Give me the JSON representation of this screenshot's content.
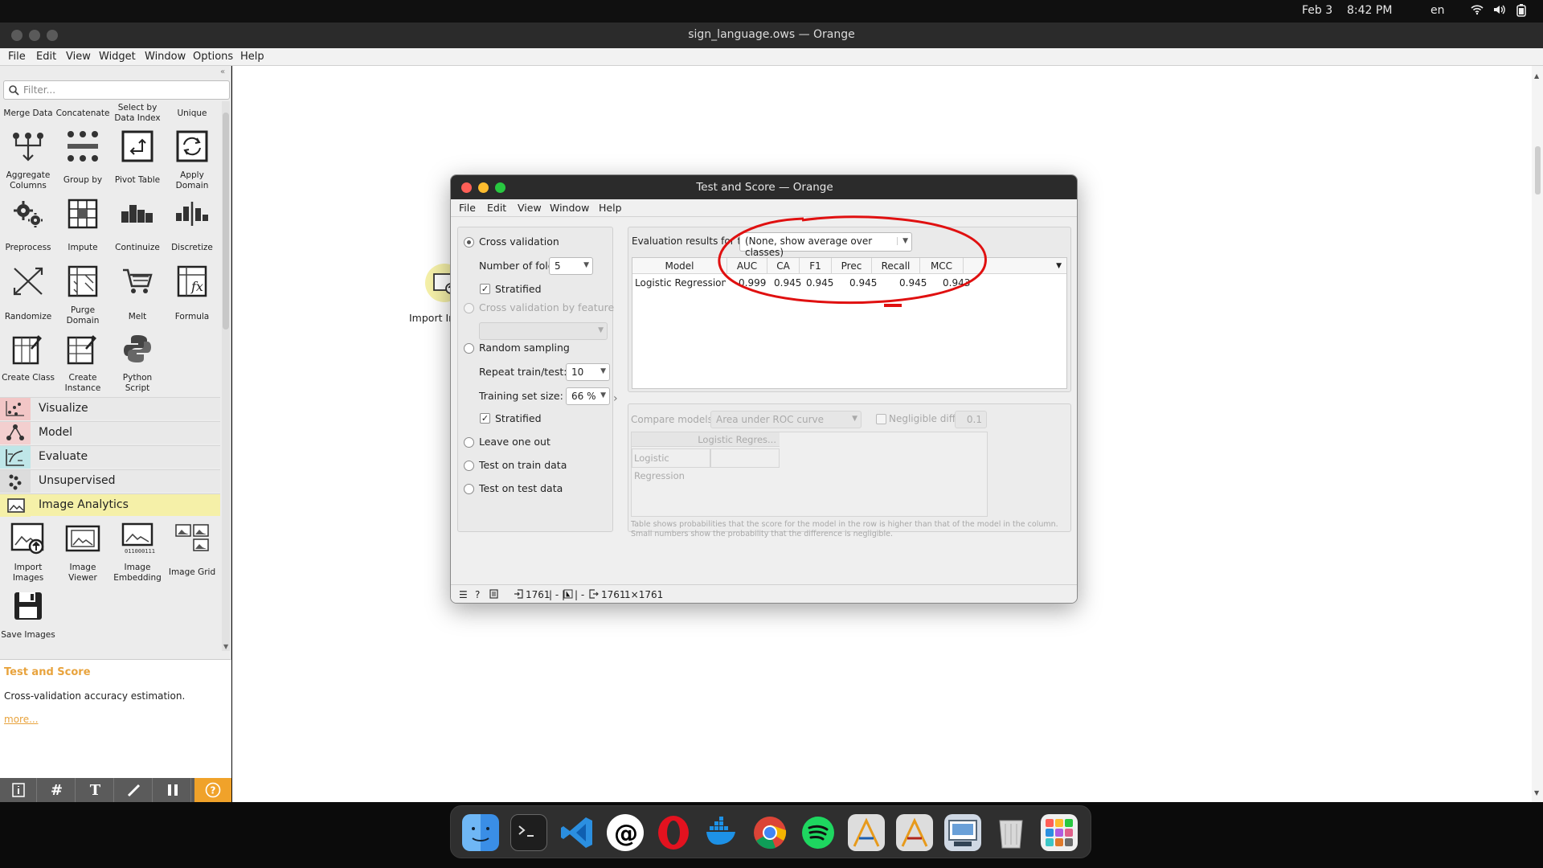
{
  "system_bar": {
    "date": "Feb 3",
    "time": "8:42 PM",
    "lang": "en"
  },
  "window": {
    "title": "sign_language.ows — Orange"
  },
  "app_menu": [
    "File",
    "Edit",
    "View",
    "Widget",
    "Window",
    "Options",
    "Help"
  ],
  "sidebar": {
    "filter_placeholder": "Filter...",
    "widgets_row1": [
      "Merge Data",
      "Concatenate",
      "Select by Data Index",
      "Unique"
    ],
    "widgets_row2": [
      "Aggregate Columns",
      "Group by",
      "Pivot Table",
      "Apply Domain"
    ],
    "widgets_row3": [
      "Preprocess",
      "Impute",
      "Continuize",
      "Discretize"
    ],
    "widgets_row4": [
      "Randomize",
      "Purge Domain",
      "Melt",
      "Formula"
    ],
    "widgets_row5": [
      "Create Class",
      "Create Instance",
      "Python Script"
    ],
    "categories": [
      "Visualize",
      "Model",
      "Evaluate",
      "Unsupervised",
      "Image Analytics"
    ],
    "image_widgets": [
      "Import Images",
      "Image Viewer",
      "Image Embedding",
      "Image Grid",
      "Save Images"
    ],
    "info": {
      "title": "Test and Score",
      "description": "Cross-validation accuracy estimation.",
      "more": "more..."
    }
  },
  "canvas": {
    "node_label": "Import Im"
  },
  "test_score": {
    "title": "Test and Score — Orange",
    "menu": [
      "File",
      "Edit",
      "View",
      "Window",
      "Help"
    ],
    "sampling": {
      "cross_validation": "Cross validation",
      "folds_label": "Number of folds:",
      "folds_value": "5",
      "stratified": "Stratified",
      "cv_by_feature": "Cross validation by feature",
      "random_sampling": "Random sampling",
      "repeat_label": "Repeat train/test:",
      "repeat_value": "10",
      "train_size_label": "Training set size:",
      "train_size_value": "66 %",
      "stratified2": "Stratified",
      "leave_one_out": "Leave one out",
      "test_on_train": "Test on train data",
      "test_on_test": "Test on test data"
    },
    "eval_label": "Evaluation results for target",
    "target_value": "(None, show average over classes)",
    "columns": [
      "Model",
      "AUC",
      "CA",
      "F1",
      "Prec",
      "Recall",
      "MCC"
    ],
    "rows": [
      {
        "model": "Logistic Regression",
        "auc": "0.999",
        "ca": "0.945",
        "f1": "0.945",
        "prec": "0.945",
        "recall": "0.945",
        "mcc": "0.943"
      }
    ],
    "compare_label": "Compare models by:",
    "compare_value": "Area under ROC curve",
    "negligible_label": "Negligible diff.:",
    "negligible_value": "0.1",
    "compare_col": "Logistic Regres...",
    "compare_row": "Logistic Regression",
    "footnote1": "Table shows probabilities that the score for the model in the row is higher than that of the model in the column.",
    "footnote2": "Small numbers show the probability that the difference is negligible.",
    "status": {
      "in_count": "1761",
      "sep1": "| - |",
      "sep2": "| -",
      "out_count": "1761",
      "out_shape": "1×1761"
    }
  },
  "colors": {
    "accent": "#e8a33d",
    "annotation": "#e01010",
    "image_analytics_bg": "#f5f0a8"
  }
}
